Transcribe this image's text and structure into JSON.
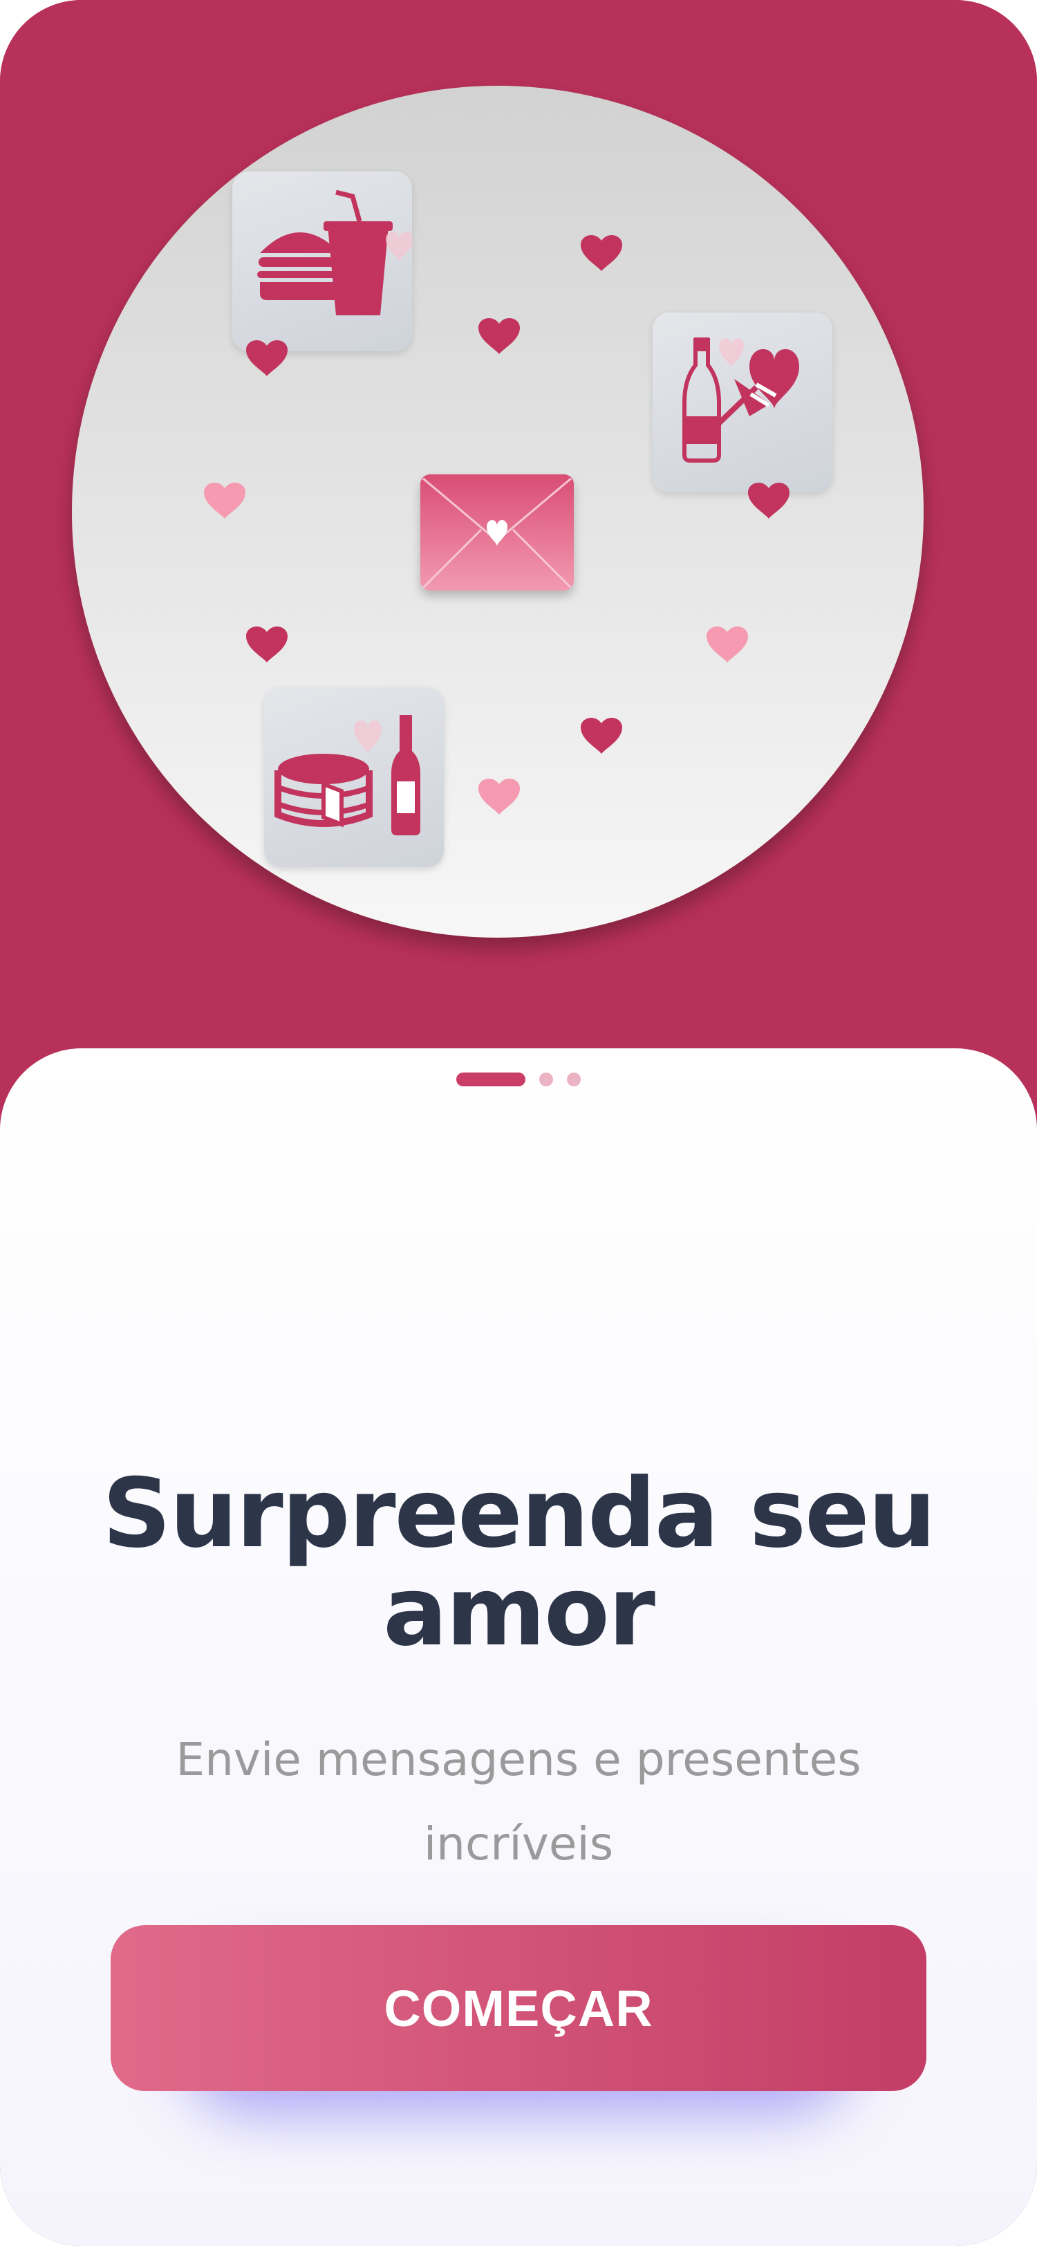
{
  "onboarding": {
    "title": "Surpreenda seu amor",
    "subtitle": "Envie mensagens e presentes incríveis",
    "cta_label": "COMEÇAR",
    "pager": {
      "pages": 3,
      "active": 1
    }
  },
  "illustration": {
    "icons": [
      "food-drink-icon",
      "champagne-flowers-icon",
      "love-letter-icon",
      "cake-wine-icon",
      "heart-icon"
    ]
  },
  "colors": {
    "brand": "#b8315a",
    "accent": "#c93d67",
    "title": "#2d3549",
    "subtitle": "#9a9a9a",
    "button_start": "#e06a89",
    "button_end": "#c33d66",
    "heart_dark": "#c2345d",
    "heart_light": "#f59ab0"
  }
}
